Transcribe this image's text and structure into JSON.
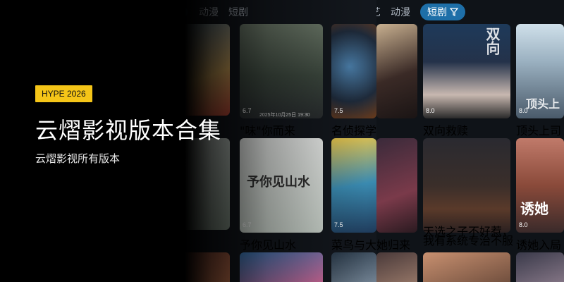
{
  "hero": {
    "badge": "HYPE 2026",
    "title": "云熠影视版本合集",
    "subtitle": "云熠影视所有版本"
  },
  "screen_left": {
    "tabs": [
      {
        "label": "动漫",
        "active": false
      },
      {
        "label": "短剧",
        "active": false
      }
    ],
    "cards": [
      {
        "score": "6.7",
        "title": "\"味\"你而来",
        "poster_text": "",
        "caption_text": "2025年10月25日 19:30"
      },
      {
        "score": "7.5",
        "title": "名侦探学院",
        "poster_text": "",
        "caption_text": ""
      },
      {
        "score": "6.7",
        "title": "予你见山水",
        "poster_text": "予你见山水",
        "caption_text": ""
      },
      {
        "score": "7.5",
        "title": "菜鸟与大鱼",
        "poster_text": "",
        "caption_text": ""
      }
    ]
  },
  "screen_right": {
    "tabs": [
      {
        "label": "动漫",
        "active": false
      },
      {
        "label": "短剧",
        "active": true
      }
    ],
    "cards": [
      {
        "score": "8.0",
        "title": "双向救赎",
        "poster_text": "双向",
        "caption_text": ""
      },
      {
        "score": "8.0",
        "title": "顶头上司竟是",
        "poster_text": "顶头上",
        "caption_text": ""
      },
      {
        "score": "",
        "title": "她归来",
        "poster_text": "",
        "caption_text": ""
      },
      {
        "score": "",
        "title": "天选之子不好惹，我有系统专治不服",
        "poster_text": "",
        "caption_text": ""
      },
      {
        "score": "8.0",
        "title": "诱她入局",
        "poster_text": "诱她",
        "caption_text": ""
      }
    ]
  },
  "colors": {
    "badge_bg": "#f5c518",
    "active_tab_bg": "#1e6fa8",
    "screen_bg": "#12161c"
  },
  "icons": [
    "filter-funnel-icon"
  ]
}
